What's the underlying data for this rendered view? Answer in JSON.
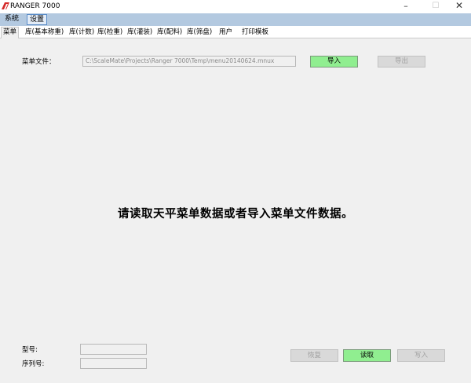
{
  "window": {
    "title": "RANGER 7000",
    "minimize_glyph": "–",
    "maximize_glyph": "☐",
    "close_glyph": "✕"
  },
  "menubar": {
    "items": [
      {
        "label": "系统"
      },
      {
        "label": "设置"
      }
    ]
  },
  "tabs": [
    {
      "label": "菜单",
      "active": true
    },
    {
      "label": "库(基本称重)"
    },
    {
      "label": "库(计数)"
    },
    {
      "label": "库(检重)"
    },
    {
      "label": "库(灌装)"
    },
    {
      "label": "库(配料)"
    },
    {
      "label": "库(筛盘)"
    },
    {
      "label": "用户"
    },
    {
      "label": "打印模板"
    }
  ],
  "menu_file": {
    "label": "菜单文件：",
    "path": "C:\\ScaleMate\\Projects\\Ranger 7000\\Temp\\menu20140624.mnux",
    "import_label": "导入",
    "export_label": "导出"
  },
  "message": "请读取天平菜单数据或者导入菜单文件数据。",
  "device": {
    "model_label": "型号:",
    "model_value": "",
    "serial_label": "序列号:",
    "serial_value": ""
  },
  "actions": {
    "reset_label": "恢复",
    "read_label": "读取",
    "write_label": "写入"
  },
  "colors": {
    "menubar": "#b3c9e0",
    "panel": "#f0f0f0",
    "green_button": "#90ee90",
    "disabled_button": "#d9d9d9",
    "logo": "#d42a2a"
  }
}
